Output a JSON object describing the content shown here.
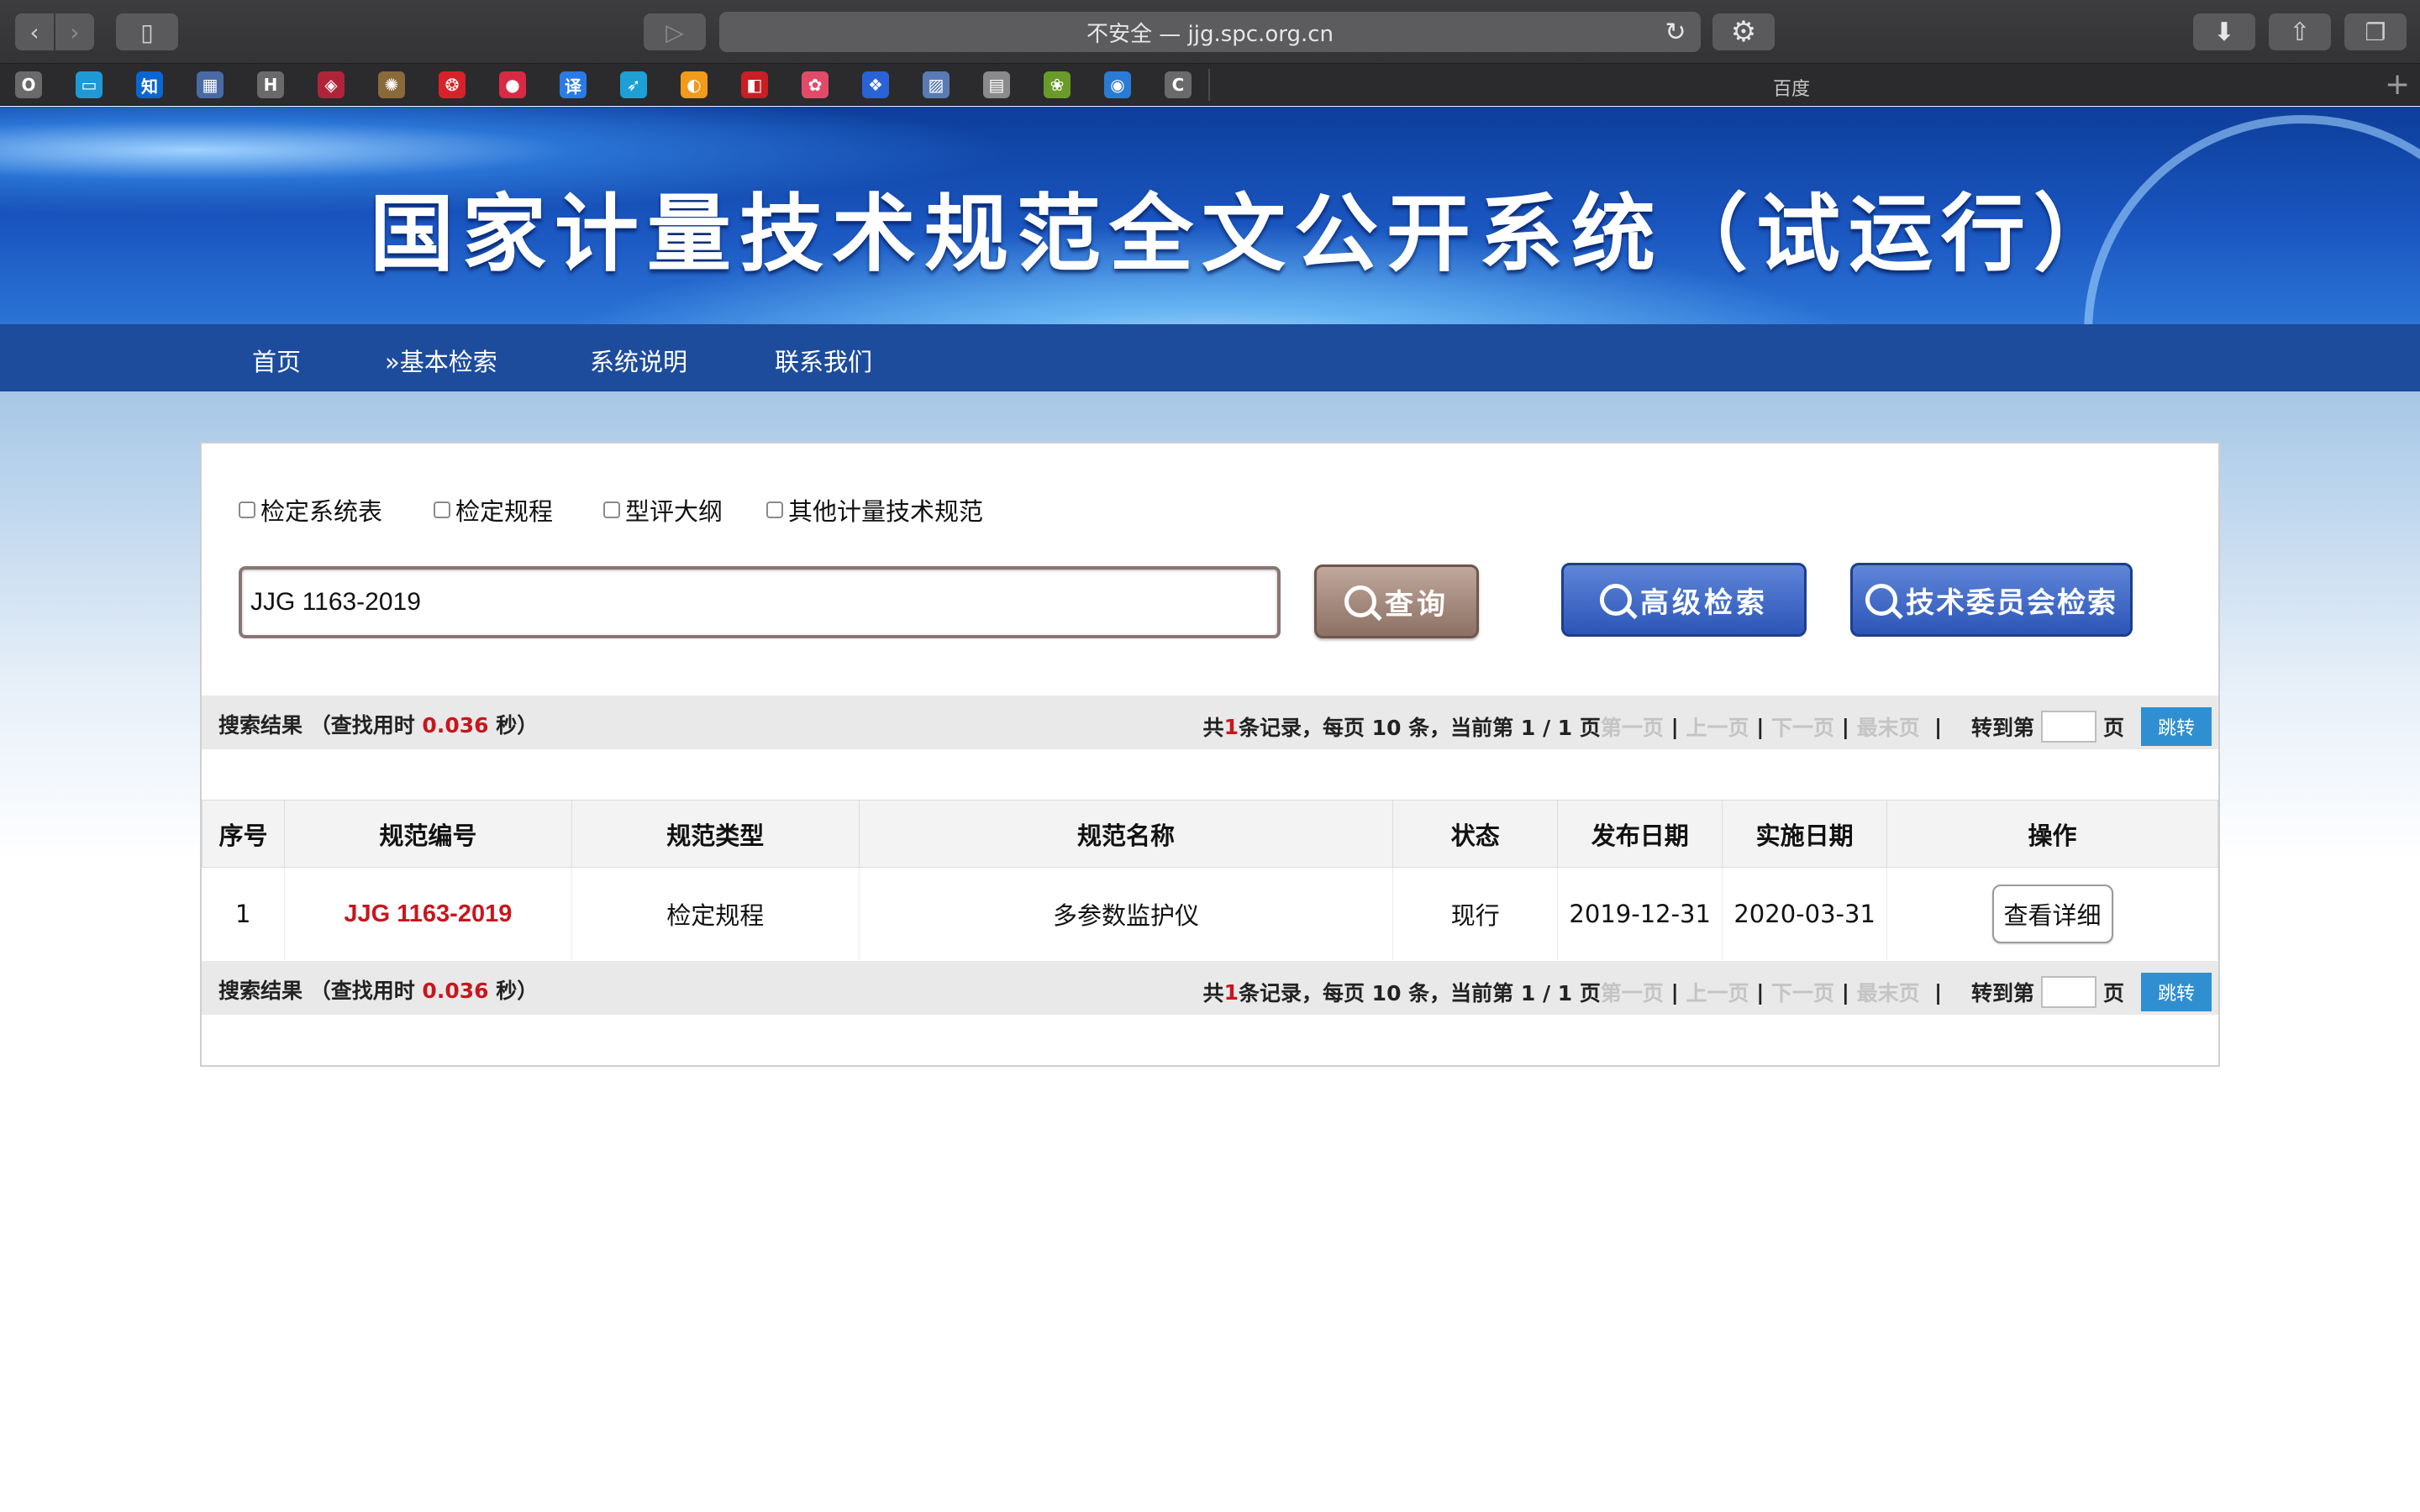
{
  "browser": {
    "url_text": "不安全 — jjg.spc.org.cn",
    "favorites_label": "百度",
    "favicons": [
      {
        "icon": "o-icon",
        "glyph": "O",
        "color": "#6a6a6a"
      },
      {
        "icon": "tv-icon",
        "glyph": "▭",
        "color": "#1d9ad6"
      },
      {
        "icon": "zhihu-icon",
        "glyph": "知",
        "color": "#0a66d1"
      },
      {
        "icon": "building-icon",
        "glyph": "▦",
        "color": "#4a6aa5"
      },
      {
        "icon": "h-icon",
        "glyph": "H",
        "color": "#6a6a6a"
      },
      {
        "icon": "badge-icon",
        "glyph": "◈",
        "color": "#b0243a"
      },
      {
        "icon": "emblem-icon",
        "glyph": "✺",
        "color": "#8a6a3a"
      },
      {
        "icon": "national-emblem-icon",
        "glyph": "❂",
        "color": "#d8222a"
      },
      {
        "icon": "red-circle-icon",
        "glyph": "●",
        "color": "#d92a45"
      },
      {
        "icon": "translate-icon",
        "glyph": "译",
        "color": "#2a7be6"
      },
      {
        "icon": "bird-icon",
        "glyph": "➶",
        "color": "#1ca0d6"
      },
      {
        "icon": "orange-circle-icon",
        "glyph": "◐",
        "color": "#f29a1a"
      },
      {
        "icon": "red-square-icon",
        "glyph": "◧",
        "color": "#c81e24"
      },
      {
        "icon": "flower-icon",
        "glyph": "✿",
        "color": "#e24a6a"
      },
      {
        "icon": "paw-icon",
        "glyph": "❖",
        "color": "#2a63d6"
      },
      {
        "icon": "image-icon",
        "glyph": "▨",
        "color": "#5a7ab5"
      },
      {
        "icon": "document-icon",
        "glyph": "▤",
        "color": "#8a8a8a"
      },
      {
        "icon": "green-icon",
        "glyph": "❀",
        "color": "#6a9a2a"
      },
      {
        "icon": "blue-circle-icon",
        "glyph": "◉",
        "color": "#2a7bd6"
      },
      {
        "icon": "c-icon",
        "glyph": "C",
        "color": "#6a6a6a"
      }
    ]
  },
  "header": {
    "title": "国家计量技术规范全文公开系统（试运行）"
  },
  "nav": {
    "items": [
      "首页",
      "»基本检索",
      "系统说明",
      "联系我们"
    ]
  },
  "filters": {
    "checkboxes": [
      "检定系统表",
      "检定规程",
      "型评大纲",
      "其他计量技术规范"
    ]
  },
  "search": {
    "value": "JJG 1163-2019",
    "query_label": "查询",
    "advanced_label": "高级检索",
    "committee_label": "技术委员会检索"
  },
  "pager": {
    "results_prefix": "搜索结果 （查找用时 ",
    "elapsed": "0.036",
    "results_suffix": " 秒）",
    "total_prefix": "共",
    "total": "1",
    "total_suffix": " 条记录，每页 10 条，当前第 1 / 1 页 ",
    "first": "第一页",
    "prev": "上一页",
    "next": "下一页",
    "last": "最末页",
    "goto_prefix": "转到第",
    "goto_suffix": "页",
    "jump_label": "跳转"
  },
  "table": {
    "headers": [
      "序号",
      "规范编号",
      "规范类型",
      "规范名称",
      "状态",
      "发布日期",
      "实施日期",
      "操作"
    ],
    "rows": [
      {
        "index": "1",
        "code": "JJG 1163-2019",
        "type": "检定规程",
        "name": "多参数监护仪",
        "status": "现行",
        "publish_date": "2019-12-31",
        "effective_date": "2020-03-31",
        "action": "查看详细"
      }
    ]
  },
  "colors": {
    "nav_bar": "#1d4c9c",
    "highlight_red": "#c8161d",
    "jump_button": "#2f8fd1"
  }
}
